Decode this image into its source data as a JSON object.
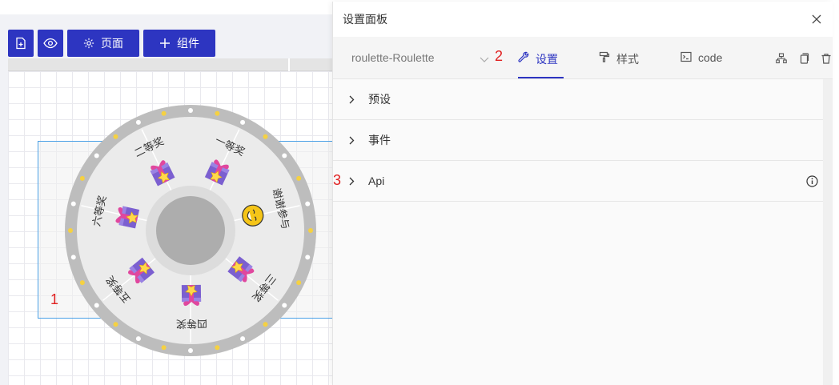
{
  "toolbar": {
    "new_page_icon": "file-plus-icon",
    "preview_icon": "eye-icon",
    "page_label": "页面",
    "component_label": "组件"
  },
  "canvas": {
    "marker": "1"
  },
  "roulette": {
    "prizes": [
      "一等奖",
      "谢谢参与",
      "三等奖",
      "四等奖",
      "五等奖",
      "六等奖",
      "二等奖"
    ],
    "rim_color": "#bdbdbd",
    "sector_color": "#ebebeb",
    "hub_color": "#adadad",
    "dot_colors": [
      "#ffffff",
      "#f5d142"
    ]
  },
  "panel": {
    "title": "设置面板",
    "component_select": "roulette-Roulette",
    "marker_tabs": "2",
    "tabs": [
      {
        "label": "设置",
        "icon": "wrench-icon",
        "active": true
      },
      {
        "label": "样式",
        "icon": "paint-roller-icon",
        "active": false
      },
      {
        "label": "code",
        "icon": "terminal-icon",
        "active": false
      }
    ],
    "tool_icons": [
      "sitemap-icon",
      "copy-icon",
      "trash-icon"
    ],
    "sections": [
      {
        "label": "预设"
      },
      {
        "label": "事件"
      },
      {
        "label": "Api",
        "marker": "3"
      }
    ],
    "accent": "#2d35c1"
  }
}
